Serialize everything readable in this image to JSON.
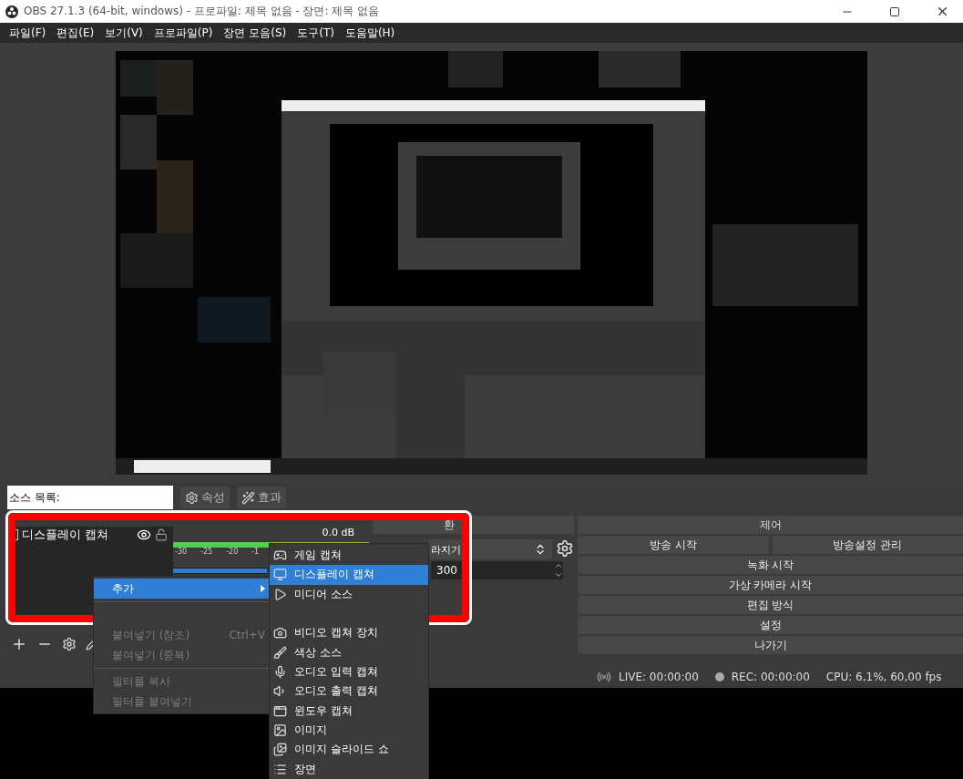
{
  "window": {
    "title": "OBS 27.1.3 (64-bit, windows) - 프로파일: 제목 없음 - 장면: 제목 없음"
  },
  "menu_bar": [
    "파일(F)",
    "편집(E)",
    "보기(V)",
    "프로파일(P)",
    "장면 모음(S)",
    "도구(T)",
    "도움말(H)"
  ],
  "dock_bar": {
    "title": "소스 목록:",
    "buttons": [
      {
        "kind": "properties",
        "label": "속성"
      },
      {
        "kind": "filters",
        "label": "효과"
      }
    ]
  },
  "sources": [
    {
      "name": "디스플레이 캡쳐",
      "visible": true,
      "locked": false
    }
  ],
  "audio_mixer": {
    "reading": "0.0 dB",
    "scale": [
      "-30",
      "-25",
      "-20",
      "-1"
    ],
    "level": 1
  },
  "transitions": {
    "header": "환",
    "transition": "라지기",
    "duration": "300"
  },
  "controls": {
    "title": "제어",
    "rows": [
      [
        "방송 시작",
        "방송설정 관리"
      ],
      [
        "녹화 시작"
      ],
      [
        "가상 카메라 시작"
      ],
      [
        "편집 방식"
      ],
      [
        "설정"
      ],
      [
        "나가기"
      ]
    ]
  },
  "status_bar": {
    "live": "LIVE: 00:00:00",
    "rec": "REC: 00:00:00",
    "cpu": "CPU: 6,1%, 60,00 fps"
  },
  "context_menu": {
    "items": [
      {
        "kind": "item",
        "label": "추가",
        "selected": true,
        "disabled": false,
        "submenu": true
      },
      {
        "kind": "separator"
      },
      {
        "kind": "item",
        "label": "붙여넣기 (참조)",
        "shortcut": "Ctrl+V",
        "selected": false,
        "disabled": true,
        "submenu": false
      },
      {
        "kind": "item",
        "label": "붙여넣기 (중복)",
        "selected": false,
        "disabled": true,
        "submenu": false
      },
      {
        "kind": "separator"
      },
      {
        "kind": "item",
        "label": "필터를 복사",
        "selected": false,
        "disabled": true,
        "submenu": false
      },
      {
        "kind": "item",
        "label": "필터를 붙여넣기",
        "selected": false,
        "disabled": true,
        "submenu": false
      }
    ]
  },
  "add_submenu": [
    {
      "label": "게임 캡쳐",
      "selected": false
    },
    {
      "label": "디스플레이 캡쳐",
      "selected": true
    },
    {
      "label": "미디어 소스",
      "selected": false
    },
    {
      "label": "비디오 캡쳐 장치",
      "selected": false
    },
    {
      "label": "색상 소스",
      "selected": false
    },
    {
      "label": "오디오 입력 캡쳐",
      "selected": false
    },
    {
      "label": "오디오 출력 캡쳐",
      "selected": false
    },
    {
      "label": "윈도우 캡쳐",
      "selected": false
    },
    {
      "label": "이미지",
      "selected": false
    },
    {
      "label": "이미지 슬라이드 쇼",
      "selected": false
    },
    {
      "label": "장면",
      "selected": false
    }
  ]
}
